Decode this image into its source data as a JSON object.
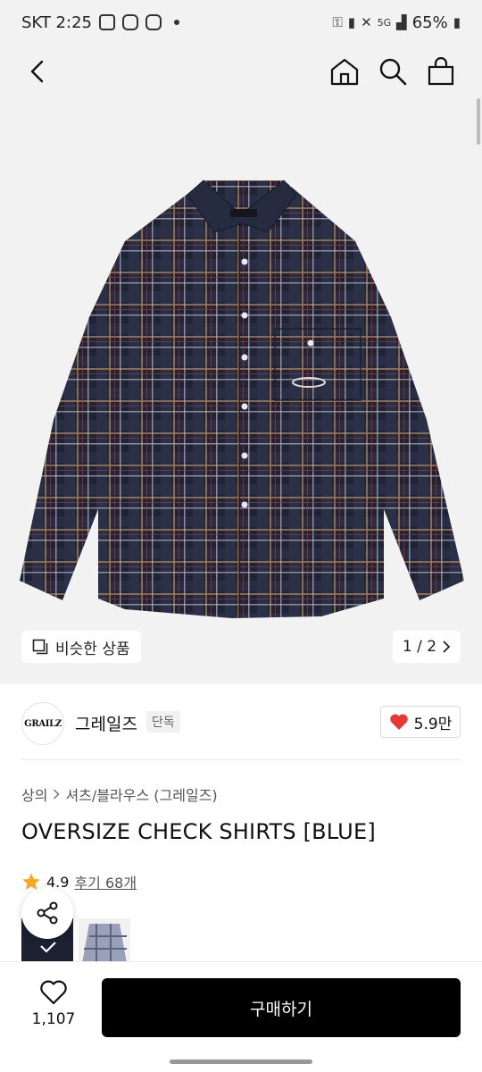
{
  "status_bar": {
    "carrier_time": "SKT 2:25",
    "network": "5G",
    "battery": "65%"
  },
  "header": {
    "back_icon": "chevron-left-icon",
    "home_icon": "home-icon",
    "search_icon": "search-icon",
    "cart_icon": "shopping-bag-icon"
  },
  "gallery": {
    "similar_label": "비슷한 상품",
    "page": "1 / 2"
  },
  "brand": {
    "logo_text": "GRAILZ",
    "name": "그레일즈",
    "badge": "단독",
    "likes": "5.9만"
  },
  "breadcrumb": {
    "category": "상의",
    "subcategory": "셔츠/블라우스 (그레일즈)"
  },
  "product": {
    "title": "OVERSIZE CHECK SHIRTS [BLUE]",
    "rating": "4.9",
    "reviews_label": "후기 68개"
  },
  "bottom": {
    "wish_count": "1,107",
    "buy_label": "구매하기"
  },
  "colors": {
    "accent": "#e53935",
    "star": "#f5a623",
    "button_bg": "#000000"
  }
}
